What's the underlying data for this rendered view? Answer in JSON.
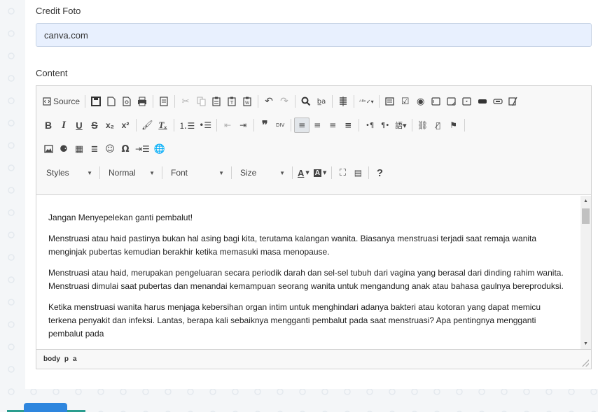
{
  "form": {
    "credit_label": "Credit Foto",
    "credit_value": "canva.com",
    "content_label": "Content"
  },
  "toolbar": {
    "row1": {
      "source_label": "Source",
      "icons": [
        "source-icon",
        "save-icon",
        "new-page-icon",
        "preview-icon",
        "print-icon",
        "templates-icon",
        "cut-icon",
        "copy-icon",
        "paste-icon",
        "paste-text-icon",
        "paste-word-icon",
        "undo-icon",
        "redo-icon",
        "find-icon",
        "replace-icon",
        "select-all-icon",
        "spellcheck-icon",
        "form-icon",
        "checkbox-icon",
        "radio-icon",
        "textfield-icon",
        "textarea-icon",
        "select-icon",
        "button-icon",
        "imagebutton-icon",
        "hiddenfield-icon"
      ]
    },
    "row2": {
      "bold": "B",
      "italic": "I",
      "underline": "U",
      "strike": "S",
      "subscript": "x₂",
      "superscript": "x²"
    },
    "row4": {
      "styles": "Styles",
      "format": "Normal",
      "font": "Font",
      "size": "Size",
      "text_color": "A",
      "help": "?"
    }
  },
  "content": {
    "paragraphs": [
      "Jangan Menyepelekan ganti pembalut!",
      "Menstruasi atau haid pastinya bukan hal asing bagi kita, terutama kalangan wanita. Biasanya menstruasi terjadi saat remaja wanita menginjak pubertas kemudian berakhir ketika memasuki masa menopause.",
      "Menstruasi atau haid, merupakan pengeluaran secara periodik darah dan sel-sel tubuh dari vagina yang berasal dari dinding rahim wanita. Menstruasi dimulai saat pubertas dan menandai kemampuan seorang wanita untuk mengandung anak atau bahasa gaulnya bereproduksi.",
      "Ketika menstruasi wanita harus menjaga kebersihan organ intim untuk menghindari adanya bakteri atau kotoran yang dapat memicu terkena penyakit dan infeksi. Lantas, berapa kali sebaiknya mengganti pembalut pada saat menstruasi? Apa pentingnya mengganti pembalut pada"
    ]
  },
  "pathbar": {
    "items": [
      "body",
      "p",
      "a"
    ]
  },
  "colors": {
    "input_bg": "#e8f0fe",
    "toolbar_bg": "#f8f8f8",
    "border": "#d1d1d1",
    "button": "#2e86de"
  }
}
